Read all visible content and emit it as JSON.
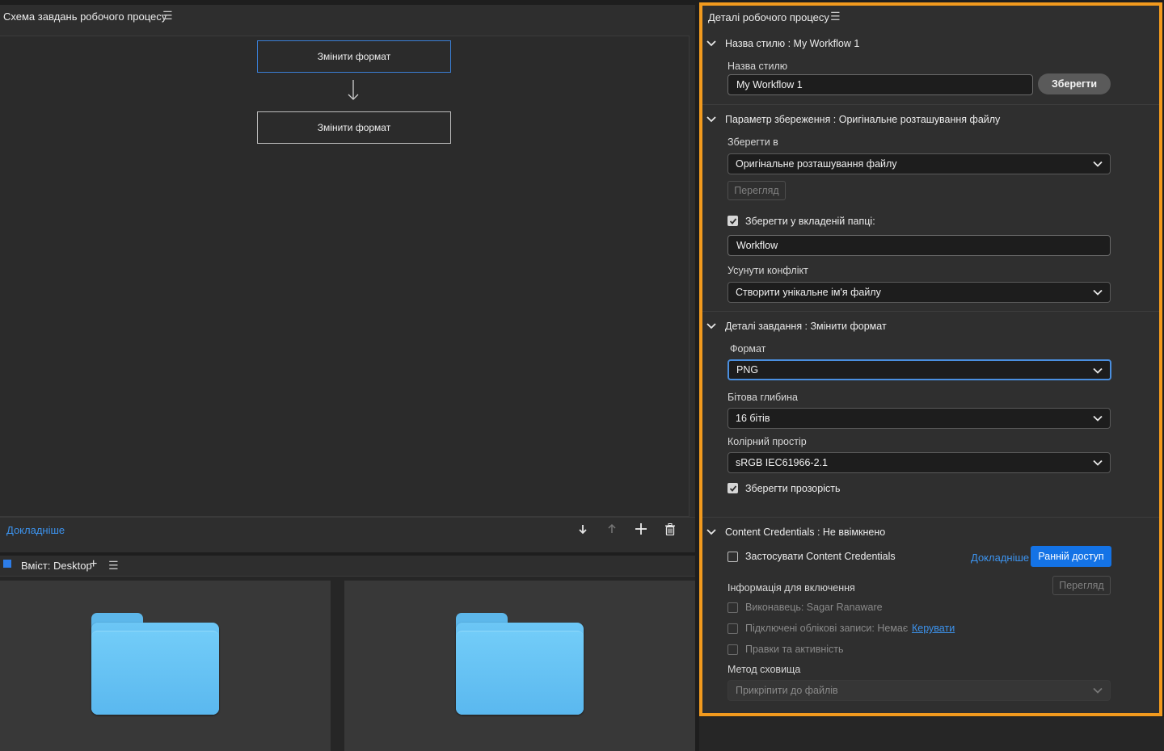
{
  "left_panel": {
    "title": "Схема завдань робочого процесу",
    "task_nodes": [
      "Змінити формат",
      "Змінити формат"
    ],
    "learn_more": "Докладніше"
  },
  "content_panel": {
    "title": "Вміст: Desktop"
  },
  "details": {
    "title": "Деталі робочого процесу",
    "style_section": {
      "title": "Назва стилю : My Workflow 1",
      "label": "Назва стилю",
      "value": "My Workflow 1",
      "save_button": "Зберегти"
    },
    "save_section": {
      "title": "Параметр збереження : Оригінальне розташування файлу",
      "save_to_label": "Зберегти в",
      "save_to_value": "Оригінальне розташування файлу",
      "browse_button": "Перегляд",
      "subfolder_checkbox": "Зберегти у вкладеній папці:",
      "subfolder_checked": true,
      "subfolder_value": "Workflow",
      "conflict_label": "Усунути конфлікт",
      "conflict_value": "Створити унікальне ім'я файлу"
    },
    "task_section": {
      "title": "Деталі завдання : Змінити формат",
      "format_label": "Формат",
      "format_value": "PNG",
      "bitdepth_label": "Бітова глибина",
      "bitdepth_value": "16 бітів",
      "colorspace_label": "Колірний простір",
      "colorspace_value": "sRGB IEC61966-2.1",
      "transparency_checkbox": "Зберегти прозорість",
      "transparency_checked": true
    },
    "cc_section": {
      "title": "Content Credentials : Не ввімкнено",
      "apply_checkbox": "Застосувати Content Credentials",
      "apply_checked": false,
      "learn_more": "Докладніше",
      "early_access_button": "Ранній доступ",
      "include_info_label": "Інформація для включення",
      "preview_button": "Перегляд",
      "artist_checkbox": "Виконавець: Sagar Ranaware",
      "accounts_checkbox": "Підключені облікові записи: Немає",
      "manage_link": "Керувати",
      "edits_checkbox": "Правки та активність",
      "storage_label": "Метод сховища",
      "storage_value": "Прикріпити до файлів"
    }
  },
  "colors": {
    "highlight_border": "#f29a1e",
    "accent_blue": "#1473e6",
    "link_blue": "#3c93ee",
    "folder_blue": "#5db7ea"
  }
}
